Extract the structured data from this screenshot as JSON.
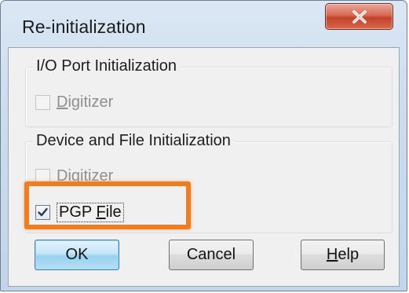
{
  "window": {
    "title": "Re-initialization",
    "close_icon": "close-icon"
  },
  "io_group": {
    "title": "I/O Port Initialization",
    "digitizer": {
      "label_mnemonic": "D",
      "label_rest": "igitizer",
      "checked": false,
      "enabled": false
    }
  },
  "device_group": {
    "title": "Device and File Initialization",
    "digitizer": {
      "label_mnemonic": "D",
      "label_rest": "igitizer",
      "checked": false,
      "enabled": false
    },
    "pgp_file": {
      "label_prefix": "PGP ",
      "label_mnemonic": "F",
      "label_rest": "ile",
      "checked": true,
      "enabled": true
    }
  },
  "buttons": {
    "ok": "OK",
    "cancel": "Cancel",
    "help_mnemonic": "H",
    "help_rest": "elp"
  },
  "colors": {
    "highlight": "#f07d1f",
    "close_button": "#c3412a"
  }
}
